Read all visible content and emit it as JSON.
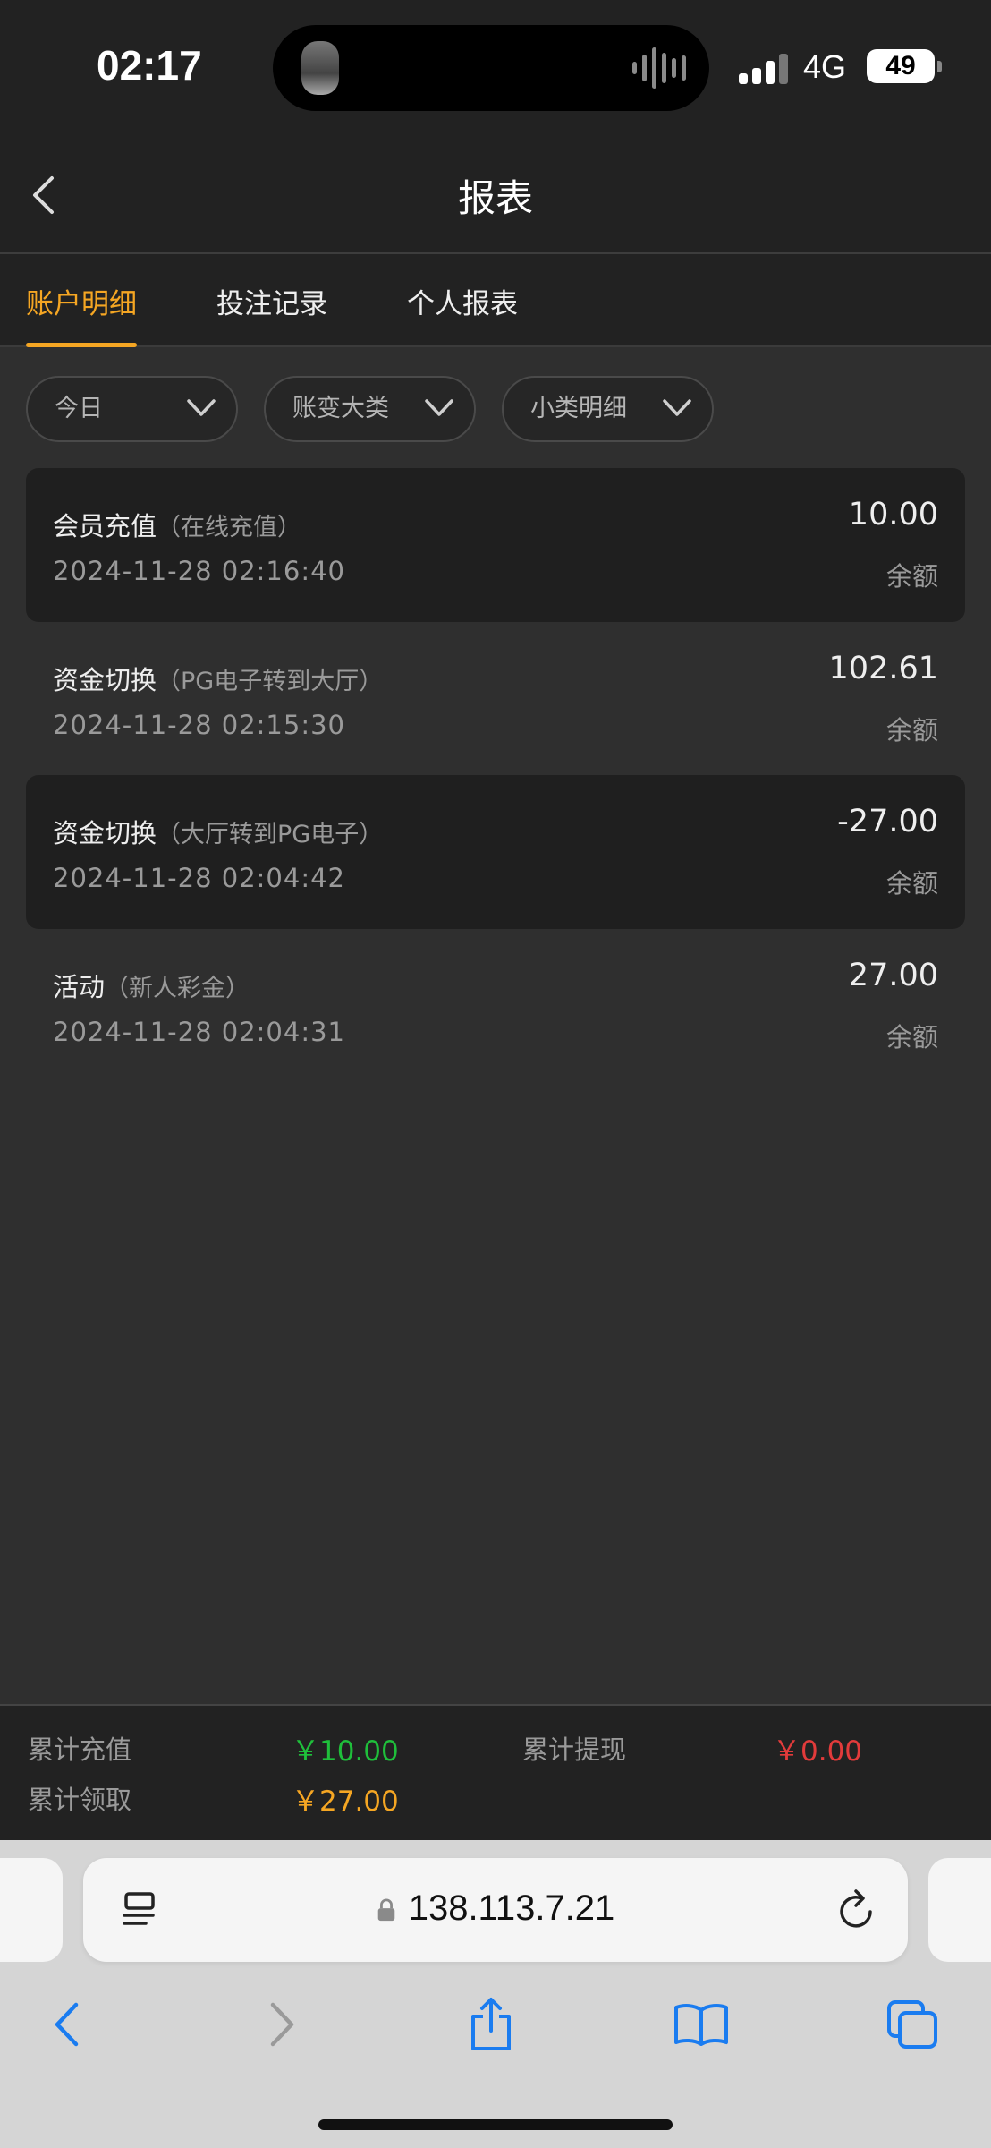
{
  "status_bar": {
    "time": "02:17",
    "network": "4G",
    "battery": "49"
  },
  "header": {
    "title": "报表"
  },
  "tabs": [
    {
      "label": "账户明细",
      "active": true
    },
    {
      "label": "投注记录",
      "active": false
    },
    {
      "label": "个人报表",
      "active": false
    }
  ],
  "filters": [
    {
      "label": "今日"
    },
    {
      "label": "账变大类"
    },
    {
      "label": "小类明细"
    }
  ],
  "records": [
    {
      "title": "会员充值",
      "sub": "（在线充值）",
      "date": "2024-11-28 02:16:40",
      "amount": "10.00",
      "balance_label": "余额"
    },
    {
      "title": "资金切换",
      "sub": "（PG电子转到大厅）",
      "date": "2024-11-28 02:15:30",
      "amount": "102.61",
      "balance_label": "余额"
    },
    {
      "title": "资金切换",
      "sub": "（大厅转到PG电子）",
      "date": "2024-11-28 02:04:42",
      "amount": "-27.00",
      "balance_label": "余额"
    },
    {
      "title": "活动",
      "sub": "（新人彩金）",
      "date": "2024-11-28 02:04:31",
      "amount": "27.00",
      "balance_label": "余额"
    }
  ],
  "summary": {
    "recharge_label": "累计充值",
    "recharge_value": "￥10.00",
    "withdraw_label": "累计提现",
    "withdraw_value": "￥0.00",
    "claim_label": "累计领取",
    "claim_value": "￥27.00"
  },
  "browser": {
    "url": "138.113.7.21"
  },
  "colors": {
    "accent": "#f5a623",
    "positive": "#1fbf3b",
    "negative": "#e23b3b",
    "link_blue": "#1a7cf0"
  }
}
